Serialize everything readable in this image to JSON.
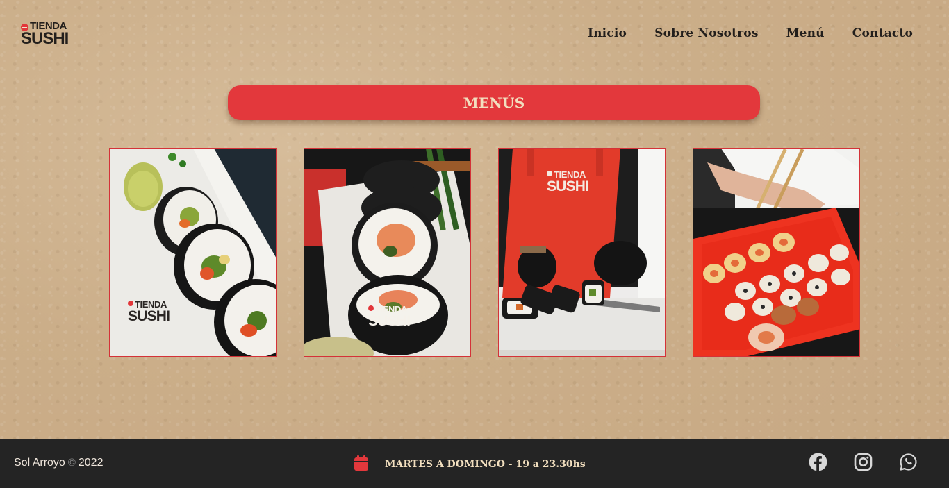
{
  "header": {
    "logo_top": "TIENDA",
    "logo_bottom": "SUSHI",
    "nav": [
      "Inicio",
      "Sobre Nosotros",
      "Menú",
      "Contacto"
    ]
  },
  "main": {
    "banner_title": "MENÚS",
    "watermark_top": "TIENDA",
    "watermark_bottom": "SUSHI"
  },
  "footer": {
    "author": "Sol Arroyo",
    "copyright_symbol": "©",
    "year": "2022",
    "hours": "MARTES A DOMINGO - 19 a 23.30hs",
    "social": [
      "facebook-icon",
      "instagram-icon",
      "whatsapp-icon"
    ]
  },
  "colors": {
    "accent": "#e3383c",
    "banner_text": "#f2dfbf",
    "footer_bg": "#242424",
    "nav_text": "#231f1c"
  }
}
